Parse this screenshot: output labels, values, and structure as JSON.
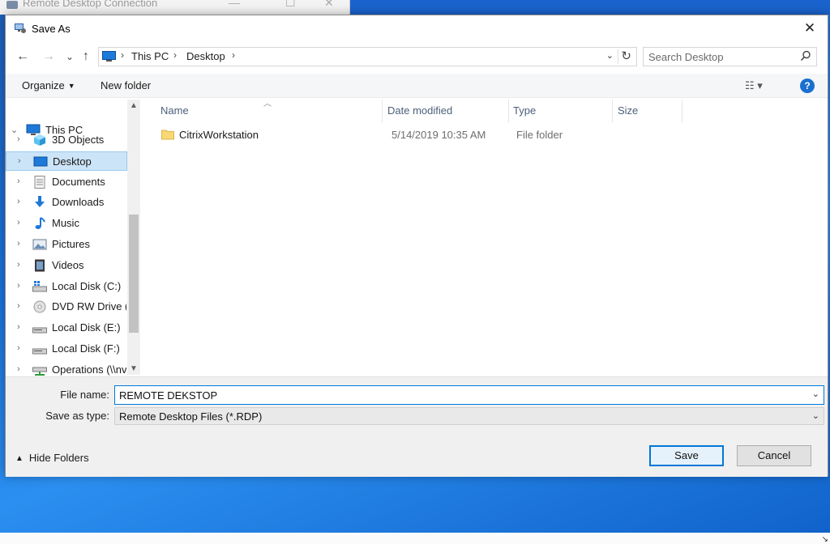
{
  "background_window": {
    "title": "Remote Desktop Connection"
  },
  "dialog": {
    "title": "Save As",
    "close_glyph": "✕"
  },
  "nav": {
    "back_glyph": "←",
    "forward_glyph": "→",
    "recent_glyph": "⌄",
    "up_glyph": "↑",
    "breadcrumb": [
      "This PC",
      "Desktop"
    ],
    "crumb_separator": "›",
    "refresh_glyph": "↻",
    "search_placeholder": "Search Desktop"
  },
  "toolbar": {
    "organize_label": "Organize",
    "new_folder_label": "New folder",
    "view_glyph": "☷ ▾",
    "help_glyph": "?"
  },
  "tree": {
    "items": [
      {
        "label": "This PC",
        "icon": "computer-icon",
        "root": true
      },
      {
        "label": "3D Objects",
        "icon": "3d-objects-icon"
      },
      {
        "label": "Desktop",
        "icon": "desktop-icon",
        "selected": true
      },
      {
        "label": "Documents",
        "icon": "documents-icon"
      },
      {
        "label": "Downloads",
        "icon": "downloads-icon"
      },
      {
        "label": "Music",
        "icon": "music-icon"
      },
      {
        "label": "Pictures",
        "icon": "pictures-icon"
      },
      {
        "label": "Videos",
        "icon": "videos-icon"
      },
      {
        "label": "Local Disk (C:)",
        "icon": "local-disk-icon"
      },
      {
        "label": "DVD RW Drive (D",
        "icon": "dvd-drive-icon"
      },
      {
        "label": "Local Disk (E:)",
        "icon": "drive-icon"
      },
      {
        "label": "Local Disk (F:)",
        "icon": "drive-icon"
      },
      {
        "label": "Operations (\\\\nv",
        "icon": "network-drive-icon"
      }
    ]
  },
  "files": {
    "columns": [
      "Name",
      "Date modified",
      "Type",
      "Size"
    ],
    "rows": [
      {
        "name": "CitrixWorkstation",
        "date": "5/14/2019 10:35 AM",
        "type": "File folder",
        "size": ""
      }
    ]
  },
  "form": {
    "filename_label": "File name:",
    "filename_value": "REMOTE DEKSTOP",
    "savetype_label": "Save as type:",
    "savetype_value": "Remote Desktop Files (*.RDP)",
    "hide_folders_label": "Hide Folders",
    "save_label": "Save",
    "cancel_label": "Cancel"
  },
  "colors": {
    "accent": "#0078d7",
    "selection": "#cce4f7",
    "folder": "#f8d775",
    "desktop_bg": "#1a73e0"
  }
}
